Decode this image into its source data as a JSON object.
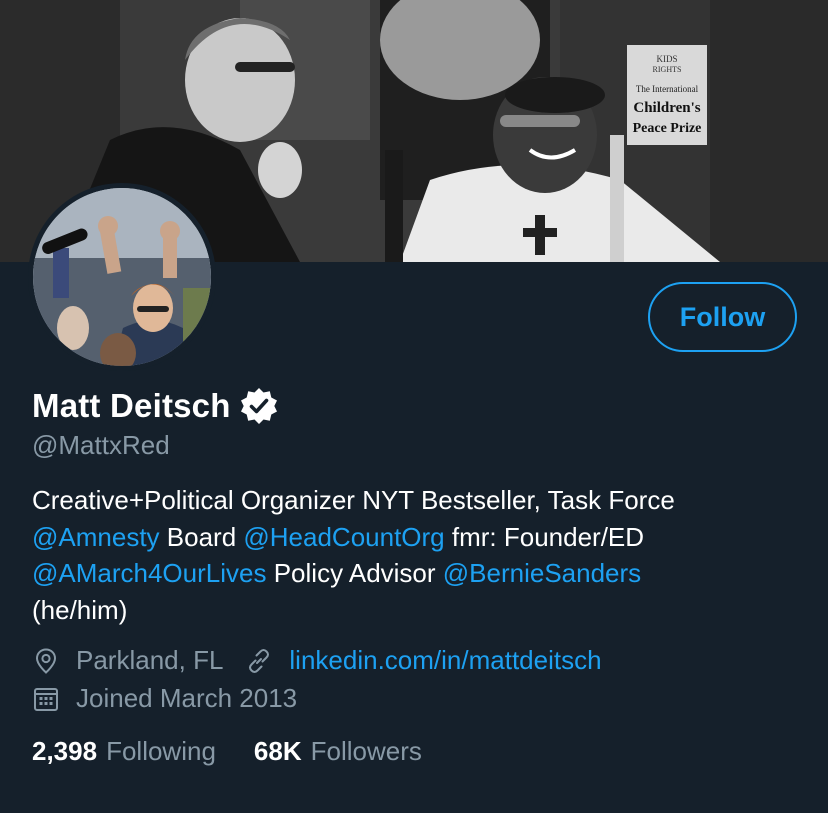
{
  "profile": {
    "name": "Matt Deitsch",
    "handle": "@MattxRed",
    "follow_label": "Follow",
    "bio": {
      "line1": "Creative+Political Organizer NYT Bestseller, Task Force",
      "mention_amnesty": "@Amnesty",
      "text_board": " Board ",
      "mention_headcount": "@HeadCountOrg",
      "text_fmr": " fmr: Founder/ED",
      "mention_march": "@AMarch4OurLives",
      "text_policy": " Policy Advisor ",
      "mention_bernie": "@BernieSanders",
      "pronouns": "(he/him)"
    },
    "location": "Parkland, FL",
    "website": "linkedin.com/in/mattdeitsch",
    "joined": "Joined March 2013",
    "stats": {
      "following_count": "2,398",
      "following_label": "Following",
      "followers_count": "68K",
      "followers_label": "Followers"
    },
    "banner_sign": {
      "line1": "KIDS",
      "line2": "RIGHTS",
      "line3": "The International",
      "line4": "Children's",
      "line5": "Peace Prize"
    }
  },
  "icons": {
    "location": "location-pin-icon",
    "link": "link-icon",
    "calendar": "calendar-icon",
    "verified": "verified-badge-icon"
  },
  "colors": {
    "background": "#15202b",
    "accent": "#1da1f2",
    "secondary_text": "#8899a6",
    "primary_text": "#ffffff"
  }
}
